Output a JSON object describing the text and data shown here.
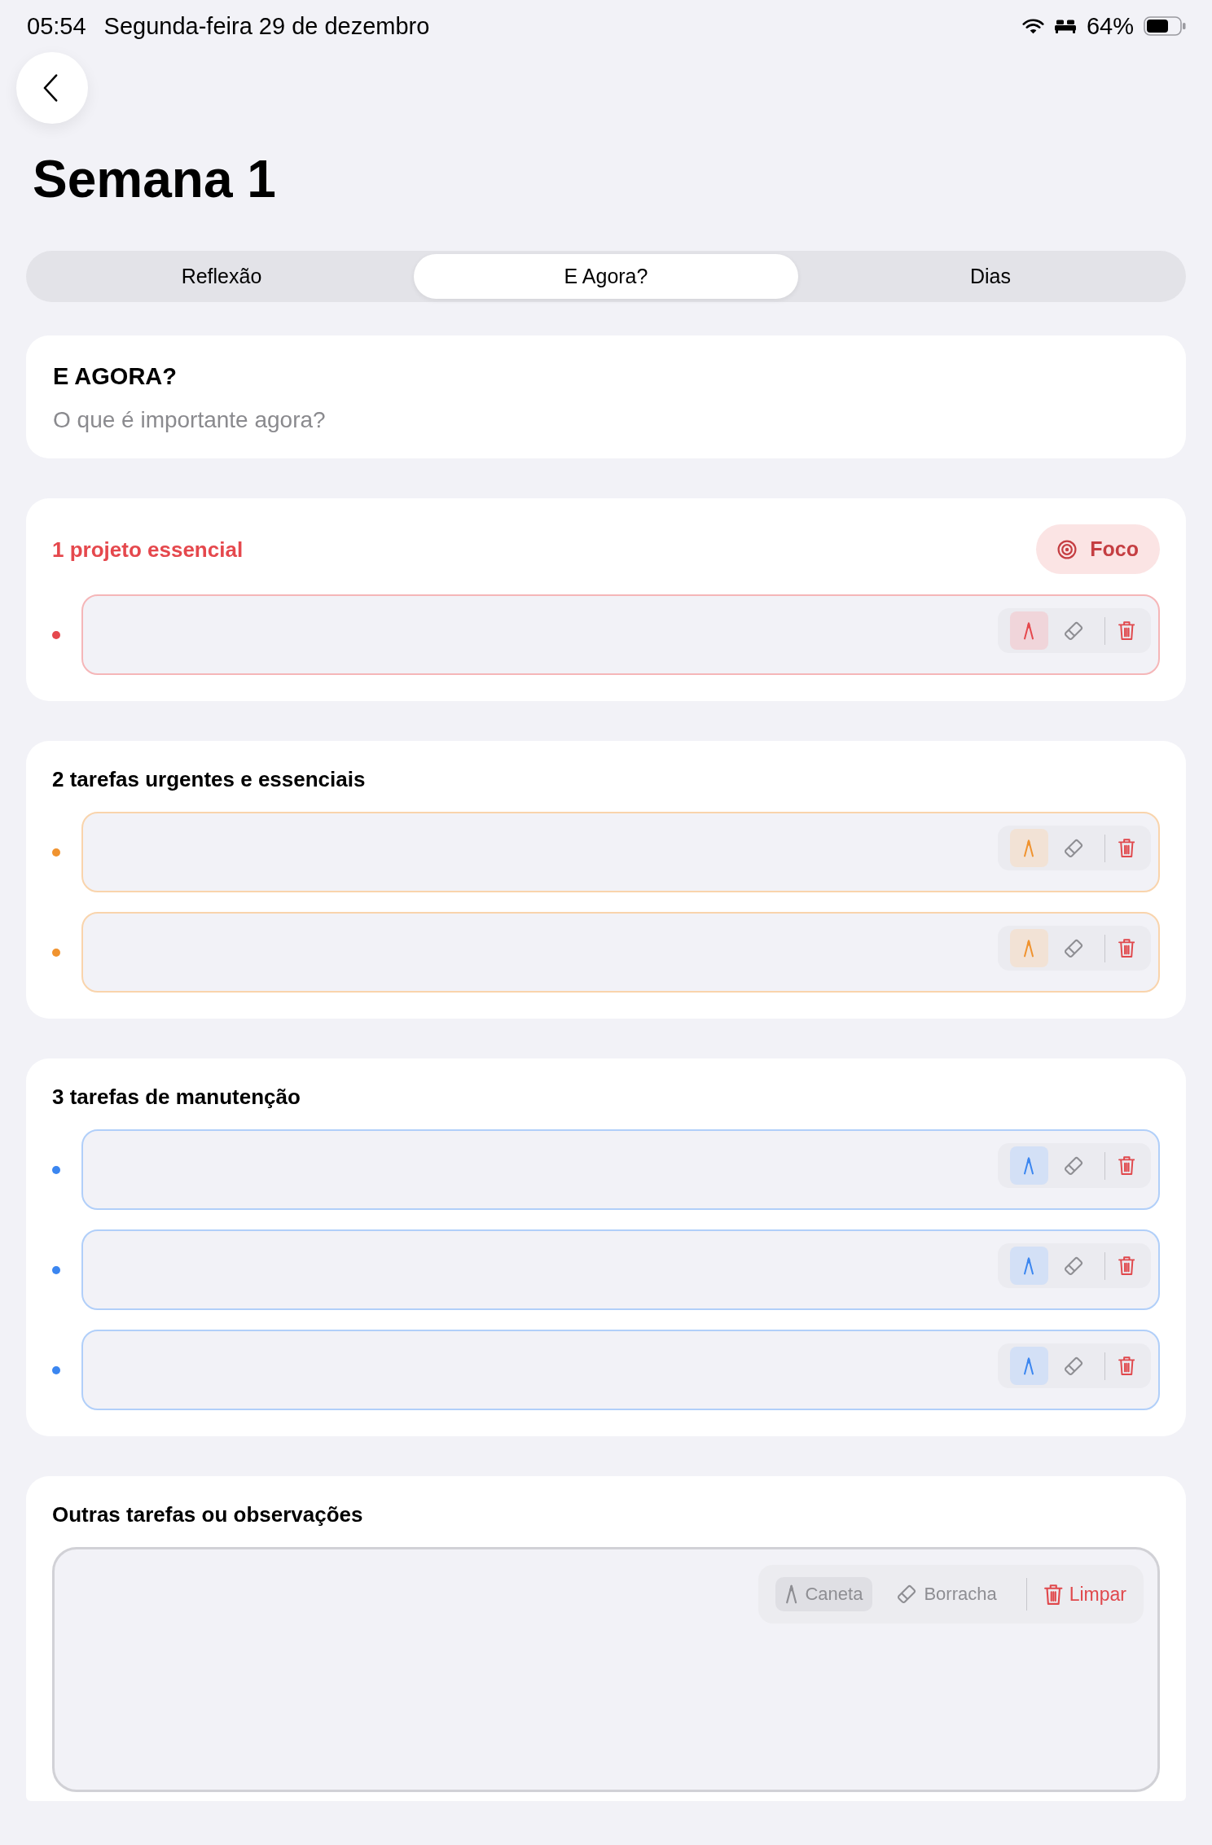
{
  "status_bar": {
    "time": "05:54",
    "date": "Segunda-feira 29 de dezembro",
    "battery": "64%"
  },
  "title": "Semana 1",
  "tabs": [
    {
      "label": "Reflexão",
      "selected": false
    },
    {
      "label": "E Agora?",
      "selected": true
    },
    {
      "label": "Dias",
      "selected": false
    }
  ],
  "intro": {
    "title": "E AGORA?",
    "subtitle": "O que é importante agora?"
  },
  "sections": [
    {
      "title": "1 projeto essencial",
      "highlighted": true,
      "color": "#e5484d",
      "badge": "Foco",
      "fields": [
        {
          "tools": [
            {
              "kind": "pen",
              "selected": true
            },
            {
              "kind": "eraser",
              "selected": false
            }
          ]
        }
      ]
    },
    {
      "title": "2 tarefas urgentes e essenciais",
      "highlighted": false,
      "color": "#f0932f",
      "fields": [
        {
          "tools": [
            {
              "kind": "pen",
              "selected": true
            },
            {
              "kind": "eraser",
              "selected": false
            }
          ]
        },
        {
          "tools": [
            {
              "kind": "pen",
              "selected": true
            },
            {
              "kind": "eraser",
              "selected": false
            }
          ]
        }
      ]
    },
    {
      "title": "3 tarefas de manutenção",
      "highlighted": false,
      "color": "#3b86f0",
      "fields": [
        {
          "tools": [
            {
              "kind": "pen",
              "selected": true
            },
            {
              "kind": "eraser",
              "selected": false
            }
          ]
        },
        {
          "tools": [
            {
              "kind": "pen",
              "selected": true
            },
            {
              "kind": "eraser",
              "selected": false
            }
          ]
        },
        {
          "tools": [
            {
              "kind": "pen",
              "selected": true
            },
            {
              "kind": "eraser",
              "selected": false
            }
          ]
        }
      ]
    }
  ],
  "notes": {
    "title": "Outras tarefas ou observações",
    "tools": [
      {
        "kind": "pen",
        "label": "Caneta",
        "selected": true
      },
      {
        "kind": "eraser",
        "label": "Borracha",
        "selected": false
      }
    ],
    "clear_label": "Limpar"
  }
}
